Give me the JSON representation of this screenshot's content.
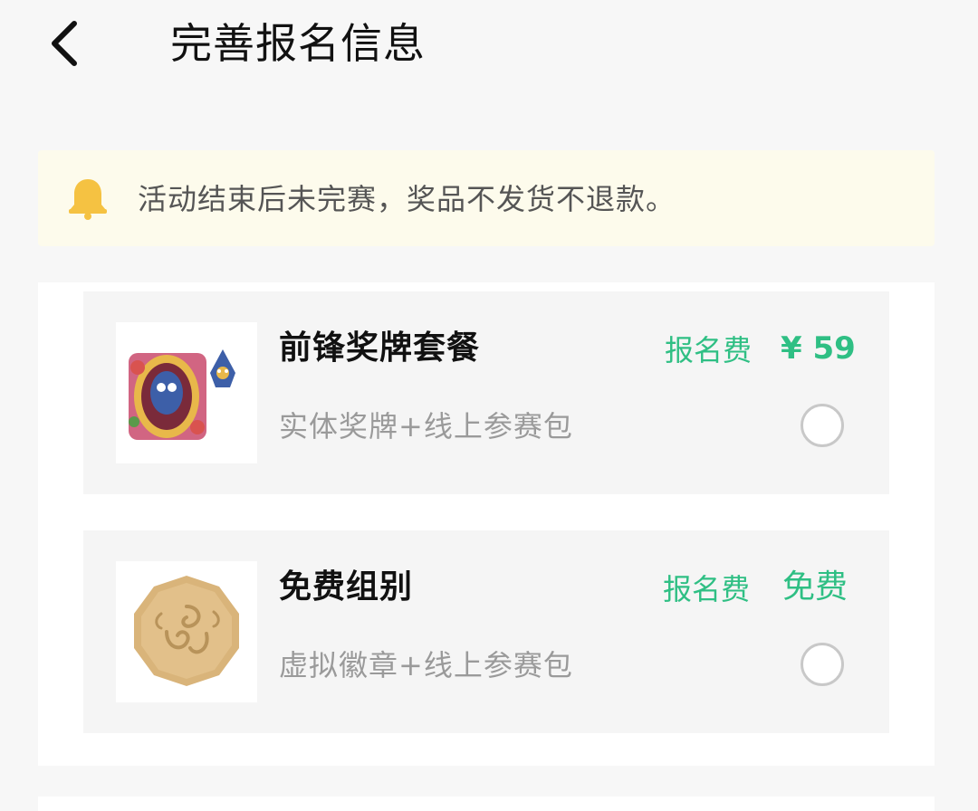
{
  "header": {
    "back_icon": "chevron-left-icon",
    "title": "完善报名信息"
  },
  "notice": {
    "icon": "bell-icon",
    "icon_color": "#f5c242",
    "text": "活动结束后未完赛，奖品不发货不退款。"
  },
  "options": [
    {
      "name": "前锋奖牌套餐",
      "description": "实体奖牌+线上参赛包",
      "fee_label": "报名费",
      "fee_value": "¥ 59",
      "selected": false,
      "image": "medal-package-image"
    },
    {
      "name": "免费组别",
      "description": "虚拟徽章+线上参赛包",
      "fee_label": "报名费",
      "fee_value": "免费",
      "selected": false,
      "image": "virtual-badge-image"
    }
  ],
  "colors": {
    "accent": "#2fbf84",
    "notice_bg": "#fdfbec",
    "page_bg": "#f7f7f7"
  }
}
